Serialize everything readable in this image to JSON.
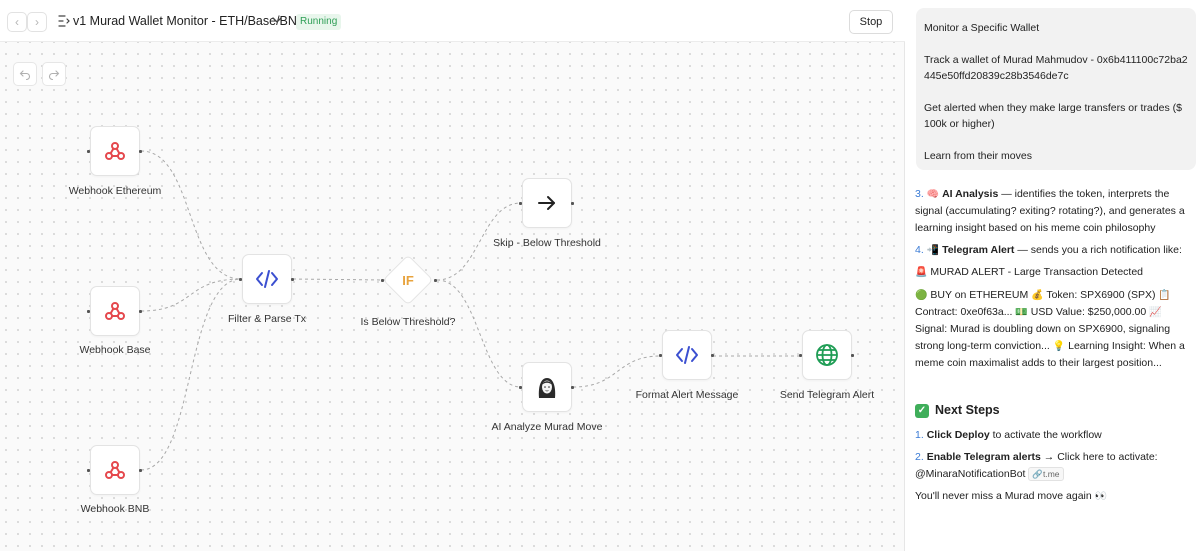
{
  "toolbar": {
    "workflow_title": "v1 Murad Wallet Monitor - ETH/Base/BNB",
    "status": "Running",
    "stop_label": "Stop",
    "back_icon": "chevron-left-icon",
    "forward_icon": "chevron-right-icon"
  },
  "nodes": {
    "webhook_eth": "Webhook Ethereum",
    "webhook_base": "Webhook Base",
    "webhook_bnb": "Webhook BNB",
    "filter": "Filter & Parse Tx",
    "if_node": "Is Below Threshold?",
    "if_text": "IF",
    "skip": "Skip - Below Threshold",
    "ai": "AI Analyze Murad Move",
    "format": "Format Alert Message",
    "telegram": "Send Telegram Alert"
  },
  "panel": {
    "bubble": {
      "title": "Monitor a Specific Wallet",
      "track": "Track a wallet of Murad Mahmudov - 0x6b411100c72ba2445e50ffd20839c28b3546de7c",
      "alert": "Get alerted when they make large transfers or trades ($ 100k or higher)",
      "learn": "Learn from their moves"
    },
    "step3": {
      "num": "3.",
      "title": "AI Analysis",
      "text": " — identifies the token, interprets the signal (accumulating? exiting? rotating?), and generates a learning insight based on his meme coin philosophy"
    },
    "step4": {
      "num": "4.",
      "title": "Telegram Alert",
      "text": " — sends you a rich notification like:"
    },
    "alert_title": "MURAD ALERT - Large Transaction Detected",
    "alert_body": {
      "a": "BUY on ETHEREUM",
      "b": "Token: SPX6900 (SPX)",
      "c": "Contract: 0xe0f63a...",
      "d": "USD Value: $250,000.00",
      "e": "Signal: Murad is doubling down on SPX6900, signaling strong long-term conviction...",
      "f": "Learning Insight: When a meme coin maximalist adds to their largest position..."
    },
    "next_steps": {
      "heading": "Next Steps",
      "s1_num": "1.",
      "s1_bold": "Click Deploy",
      "s1_text": " to activate the workflow",
      "s2_num": "2.",
      "s2_bold": "Enable Telegram alerts",
      "s2_text": " → Click here to activate:",
      "bot": "@MinaraNotificationBot",
      "link": "t.me"
    },
    "closing": "You'll never miss a Murad move again"
  },
  "colors": {
    "accent_blue": "#3a7bd5",
    "running_green": "#2e9e55",
    "webhook_red": "#e5484d",
    "code_blue": "#3b4fd0",
    "if_orange": "#e8a33d",
    "globe_green": "#1f9d55"
  }
}
